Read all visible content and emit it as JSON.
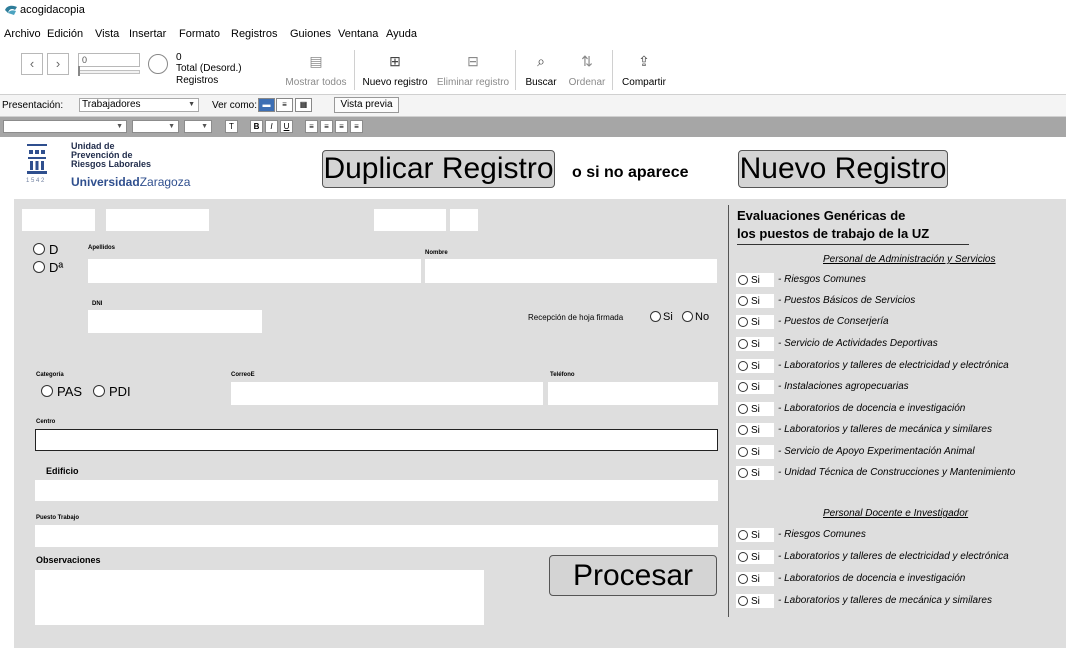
{
  "window": {
    "title": "acogidacopia"
  },
  "menu": [
    "Archivo",
    "Edición",
    "Vista",
    "Insertar",
    "Formato",
    "Registros",
    "Guiones",
    "Ventana",
    "Ayuda"
  ],
  "toolbar": {
    "record_value": "0",
    "total_count": "0",
    "total_label": "Total (Desord.)",
    "records_label": "Registros",
    "show_all": "Mostrar todos",
    "new_record": "Nuevo registro",
    "delete_record": "Eliminar registro",
    "search": "Buscar",
    "sort": "Ordenar",
    "share": "Compartir"
  },
  "layout_bar": {
    "presentation_label": "Presentación:",
    "presentation_value": "Trabajadores",
    "view_as_label": "Ver como:",
    "preview_button": "Vista previa"
  },
  "header": {
    "unit_lines": [
      "Unidad de",
      "Prevención de",
      "Riesgos Laborales"
    ],
    "university_bold": "Universidad",
    "university_rest": "Zaragoza",
    "logo_year": "1 5 4 2",
    "duplicate_button": "Duplicar Registro",
    "or_text": "o si no aparece",
    "new_button": "Nuevo Registro"
  },
  "form": {
    "radio_d": "D",
    "radio_da": "Dª",
    "apellidos_label": "Apellidos",
    "nombre_label": "Nombre",
    "dni_label": "DNI",
    "signed_label": "Recepción de hoja firmada",
    "signed_yes": "Si",
    "signed_no": "No",
    "categoria_label": "Categoría",
    "cat_pas": "PAS",
    "cat_pdi": "PDI",
    "correo_label": "CorreoE",
    "telefono_label": "Teléfono",
    "centro_label": "Centro",
    "edificio_label": "Edificio",
    "puesto_label": "Puesto Trabajo",
    "observaciones_label": "Observaciones",
    "procesar_button": "Procesar"
  },
  "panel": {
    "title_line1": "Evaluaciones Genéricas de",
    "title_line2": "los puestos de trabajo de la UZ",
    "si_label": "Si",
    "section_pas": "Personal de Administración y Servicios",
    "pas_items": [
      "- Riesgos Comunes",
      "- Puestos Básicos de Servicios",
      "- Puestos de Conserjería",
      "- Servicio de Actividades Deportivas",
      "- Laboratorios y talleres de electricidad y electrónica",
      "- Instalaciones agropecuarias",
      "- Laboratorios de docencia e investigación",
      "- Laboratorios y talleres de mecánica y similares",
      "- Servicio de Apoyo Experimentación Animal",
      "- Unidad Técnica de Construcciones y Mantenimiento"
    ],
    "section_pdi": "Personal Docente e Investigador",
    "pdi_items": [
      "- Riesgos Comunes",
      "- Laboratorios y talleres de electricidad y electrónica",
      "- Laboratorios de docencia e investigación",
      "- Laboratorios y talleres de mecánica y similares"
    ]
  }
}
